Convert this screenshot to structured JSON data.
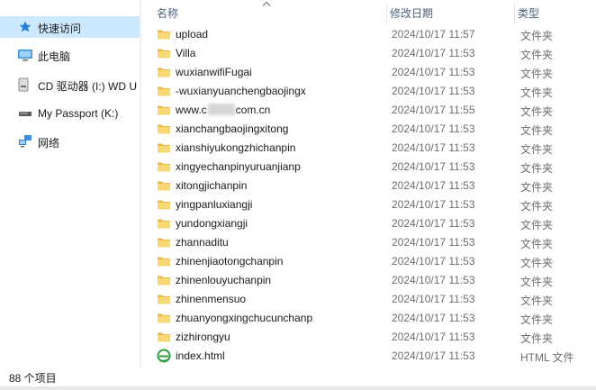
{
  "nav": {
    "items": [
      {
        "label": "快速访问",
        "icon": "star-icon",
        "selected": true
      },
      {
        "label": "此电脑",
        "icon": "computer-icon"
      },
      {
        "label": "CD 驱动器 (I:) WD U",
        "icon": "cd-drive-icon"
      },
      {
        "label": "My Passport (K:)",
        "icon": "drive-icon"
      },
      {
        "label": "网络",
        "icon": "network-icon"
      }
    ]
  },
  "columns": {
    "name": "名称",
    "date": "修改日期",
    "type": "类型"
  },
  "files": [
    {
      "name": "upload",
      "date": "2024/10/17 11:57",
      "type": "文件夹",
      "kind": "folder"
    },
    {
      "name": "Villa",
      "date": "2024/10/17 11:53",
      "type": "文件夹",
      "kind": "folder"
    },
    {
      "name": "wuxianwifiFugai",
      "date": "2024/10/17 11:53",
      "type": "文件夹",
      "kind": "folder"
    },
    {
      "name": "-wuxianyuanchengbaojingx",
      "date": "2024/10/17 11:53",
      "type": "文件夹",
      "kind": "folder"
    },
    {
      "name_prefix": "www.c",
      "name_suffix": "com.cn",
      "date": "2024/10/17 11:55",
      "type": "文件夹",
      "kind": "folder",
      "masked": true
    },
    {
      "name": "xianchangbaojingxitong",
      "date": "2024/10/17 11:53",
      "type": "文件夹",
      "kind": "folder"
    },
    {
      "name": "xianshiyukongzhichanpin",
      "date": "2024/10/17 11:53",
      "type": "文件夹",
      "kind": "folder"
    },
    {
      "name": "xingyechanpinyuruanjianp",
      "date": "2024/10/17 11:53",
      "type": "文件夹",
      "kind": "folder"
    },
    {
      "name": "xitongjichanpin",
      "date": "2024/10/17 11:53",
      "type": "文件夹",
      "kind": "folder"
    },
    {
      "name": "yingpanluxiangji",
      "date": "2024/10/17 11:53",
      "type": "文件夹",
      "kind": "folder"
    },
    {
      "name": "yundongxiangji",
      "date": "2024/10/17 11:53",
      "type": "文件夹",
      "kind": "folder"
    },
    {
      "name": "zhannaditu",
      "date": "2024/10/17 11:53",
      "type": "文件夹",
      "kind": "folder"
    },
    {
      "name": "zhinenjiaotongchanpin",
      "date": "2024/10/17 11:53",
      "type": "文件夹",
      "kind": "folder"
    },
    {
      "name": "zhinenlouyuchanpin",
      "date": "2024/10/17 11:53",
      "type": "文件夹",
      "kind": "folder"
    },
    {
      "name": "zhinenmensuo",
      "date": "2024/10/17 11:53",
      "type": "文件夹",
      "kind": "folder"
    },
    {
      "name": "zhuanyongxingchucunchanp",
      "date": "2024/10/17 11:53",
      "type": "文件夹",
      "kind": "folder"
    },
    {
      "name": "zizhirongyu",
      "date": "2024/10/17 11:53",
      "type": "文件夹",
      "kind": "folder"
    },
    {
      "name": "index.html",
      "date": "2024/10/17 11:53",
      "type": "HTML 文件",
      "kind": "html"
    }
  ],
  "status": {
    "item_count": "88 个项目"
  },
  "colors": {
    "selected_bg": "#cce8ff",
    "folder": "#f8d775",
    "header_text": "#4c607a",
    "meta_text": "#6d6d6d"
  }
}
